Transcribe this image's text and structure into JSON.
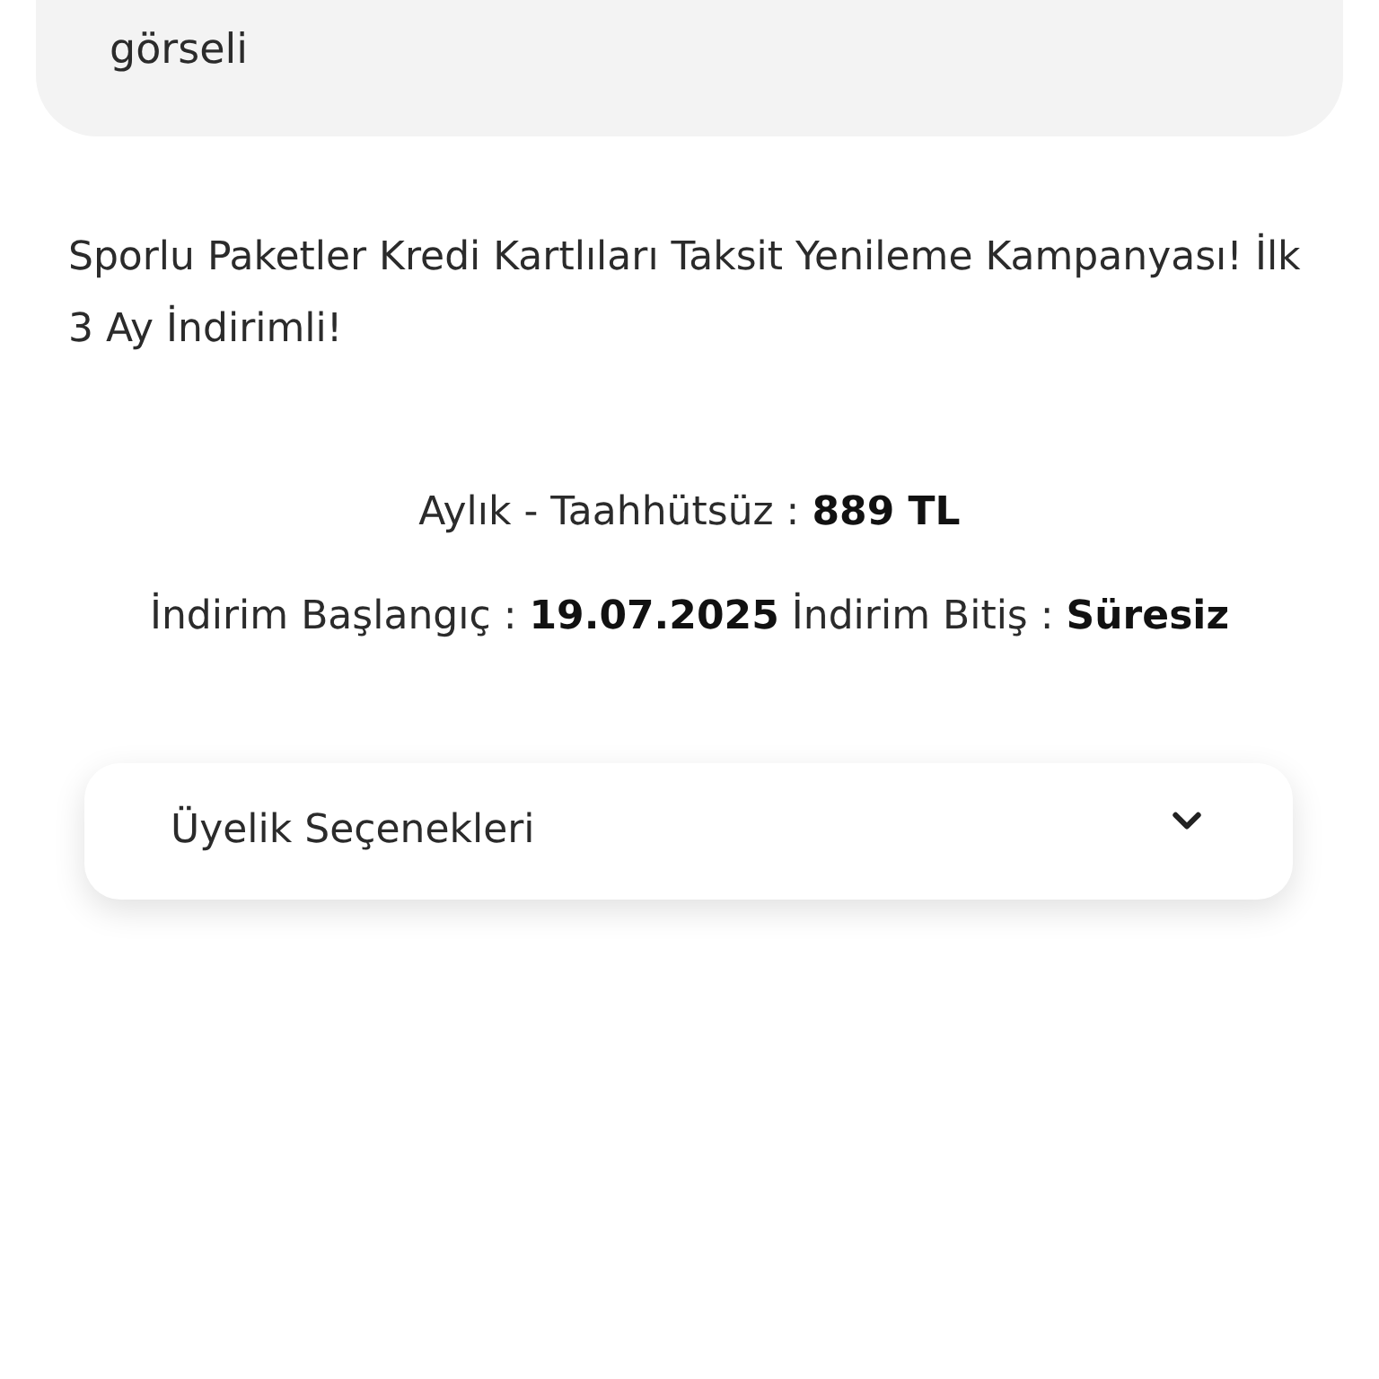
{
  "image_card": {
    "caption": "görseli"
  },
  "description": "Sporlu Paketler Kredi Kartlıları Taksit Yenileme Kampanyası! İlk 3 Ay İndirimli!",
  "price_line": "Aylık - Taahhütsüz : **889 TL**",
  "discount_line": "İndirim Başlangıç : **19.07.2025** İndirim Bitiş : **Süresiz**",
  "accordion": {
    "title": "Üyelik Seçenekleri",
    "expanded": false
  }
}
